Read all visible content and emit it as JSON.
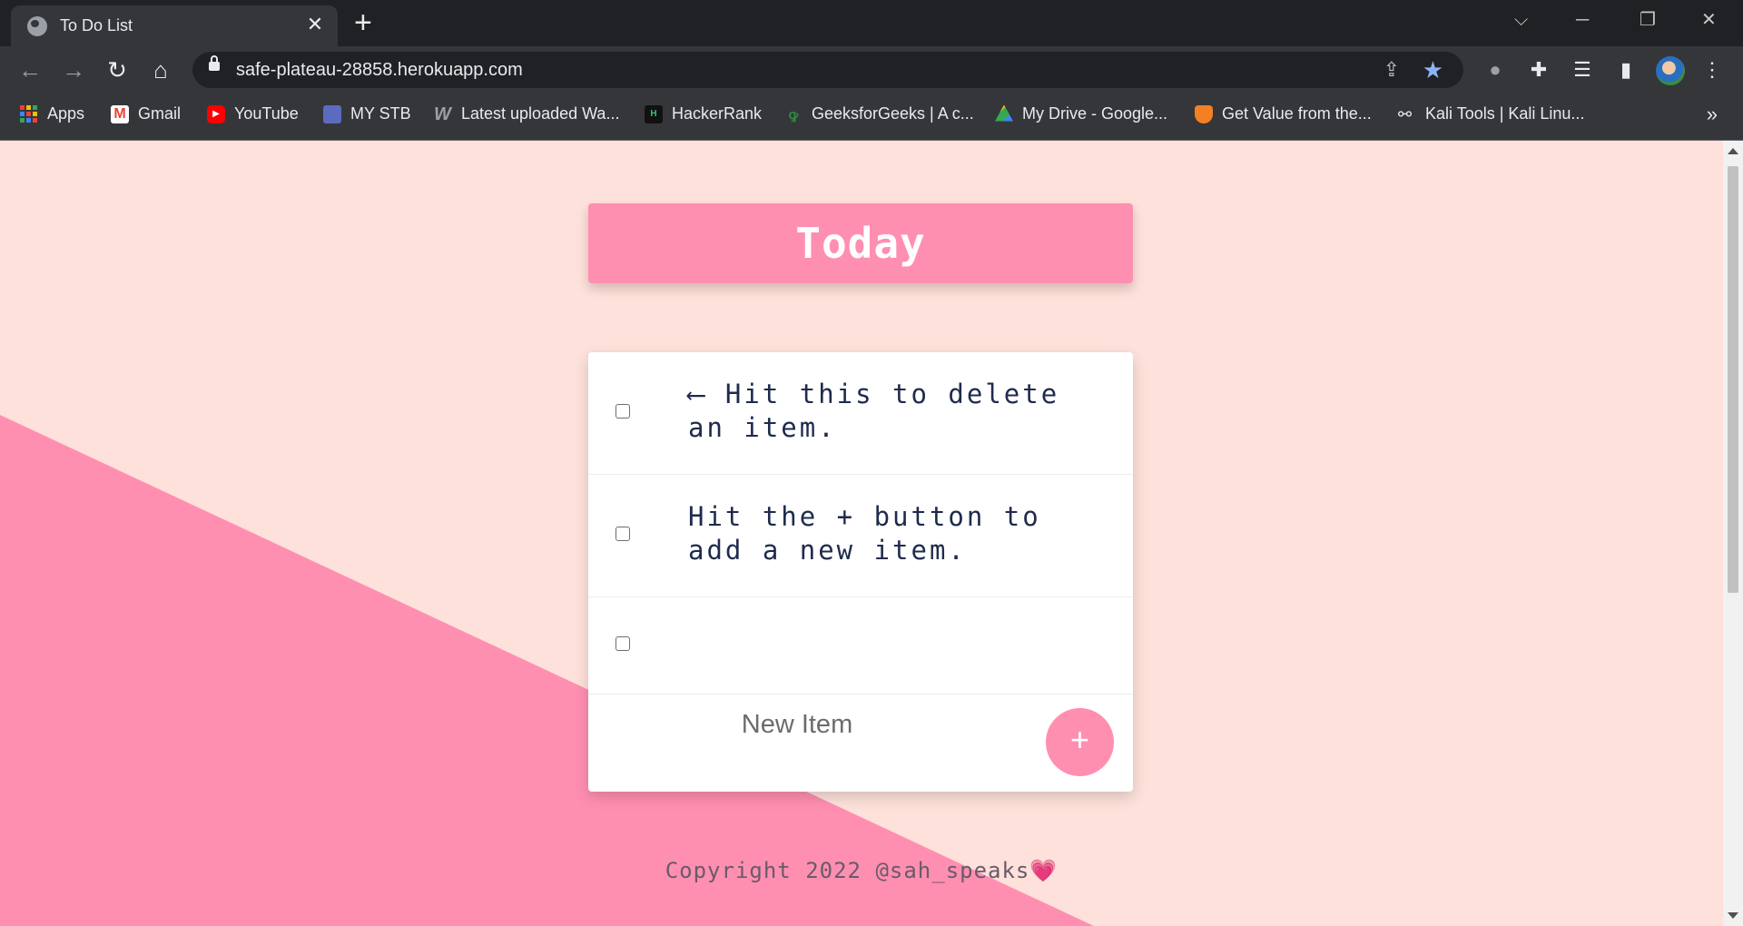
{
  "browser": {
    "tab_title": "To Do List",
    "tab_close": "✕",
    "new_tab": "+",
    "url": "safe-plateau-28858.herokuapp.com",
    "bookmarks": [
      {
        "label": "Apps",
        "icon": "apps-grid-icon"
      },
      {
        "label": "Gmail",
        "icon": "gmail-icon",
        "color": "#ea4335"
      },
      {
        "label": "YouTube",
        "icon": "youtube-icon",
        "color": "#ff0000"
      },
      {
        "label": "MY STB",
        "icon": "stb-icon",
        "color": "#5c6bc0"
      },
      {
        "label": "Latest uploaded Wa...",
        "icon": "w-logo-icon",
        "color": "#9aa0a6"
      },
      {
        "label": "HackerRank",
        "icon": "hackerrank-icon",
        "color": "#111111"
      },
      {
        "label": "GeeksforGeeks | A c...",
        "icon": "gfg-icon",
        "color": "#2f8d46"
      },
      {
        "label": "My Drive - Google...",
        "icon": "google-drive-icon",
        "color": "#fbbc04"
      },
      {
        "label": "Get Value from the...",
        "icon": "stackoverflow-icon",
        "color": "#f48024"
      },
      {
        "label": "Kali Tools | Kali Linu...",
        "icon": "kali-dragon-icon",
        "color": "#e8eaed"
      }
    ],
    "bookmarks_more": "»"
  },
  "page": {
    "heading": "Today",
    "items": [
      {
        "text": "⟵ Hit this to delete an item.",
        "checked": false
      },
      {
        "text": "Hit the + button to add a new item.",
        "checked": false
      },
      {
        "text": "",
        "checked": false
      }
    ],
    "new_item_placeholder": "New Item",
    "add_button": "+",
    "footer": "Copyright 2022 @sah_speaks",
    "footer_heart": "💗"
  },
  "colors": {
    "page_bg": "#fde1da",
    "accent_pink": "#ff8fb1",
    "item_text": "#1f2b4d"
  }
}
